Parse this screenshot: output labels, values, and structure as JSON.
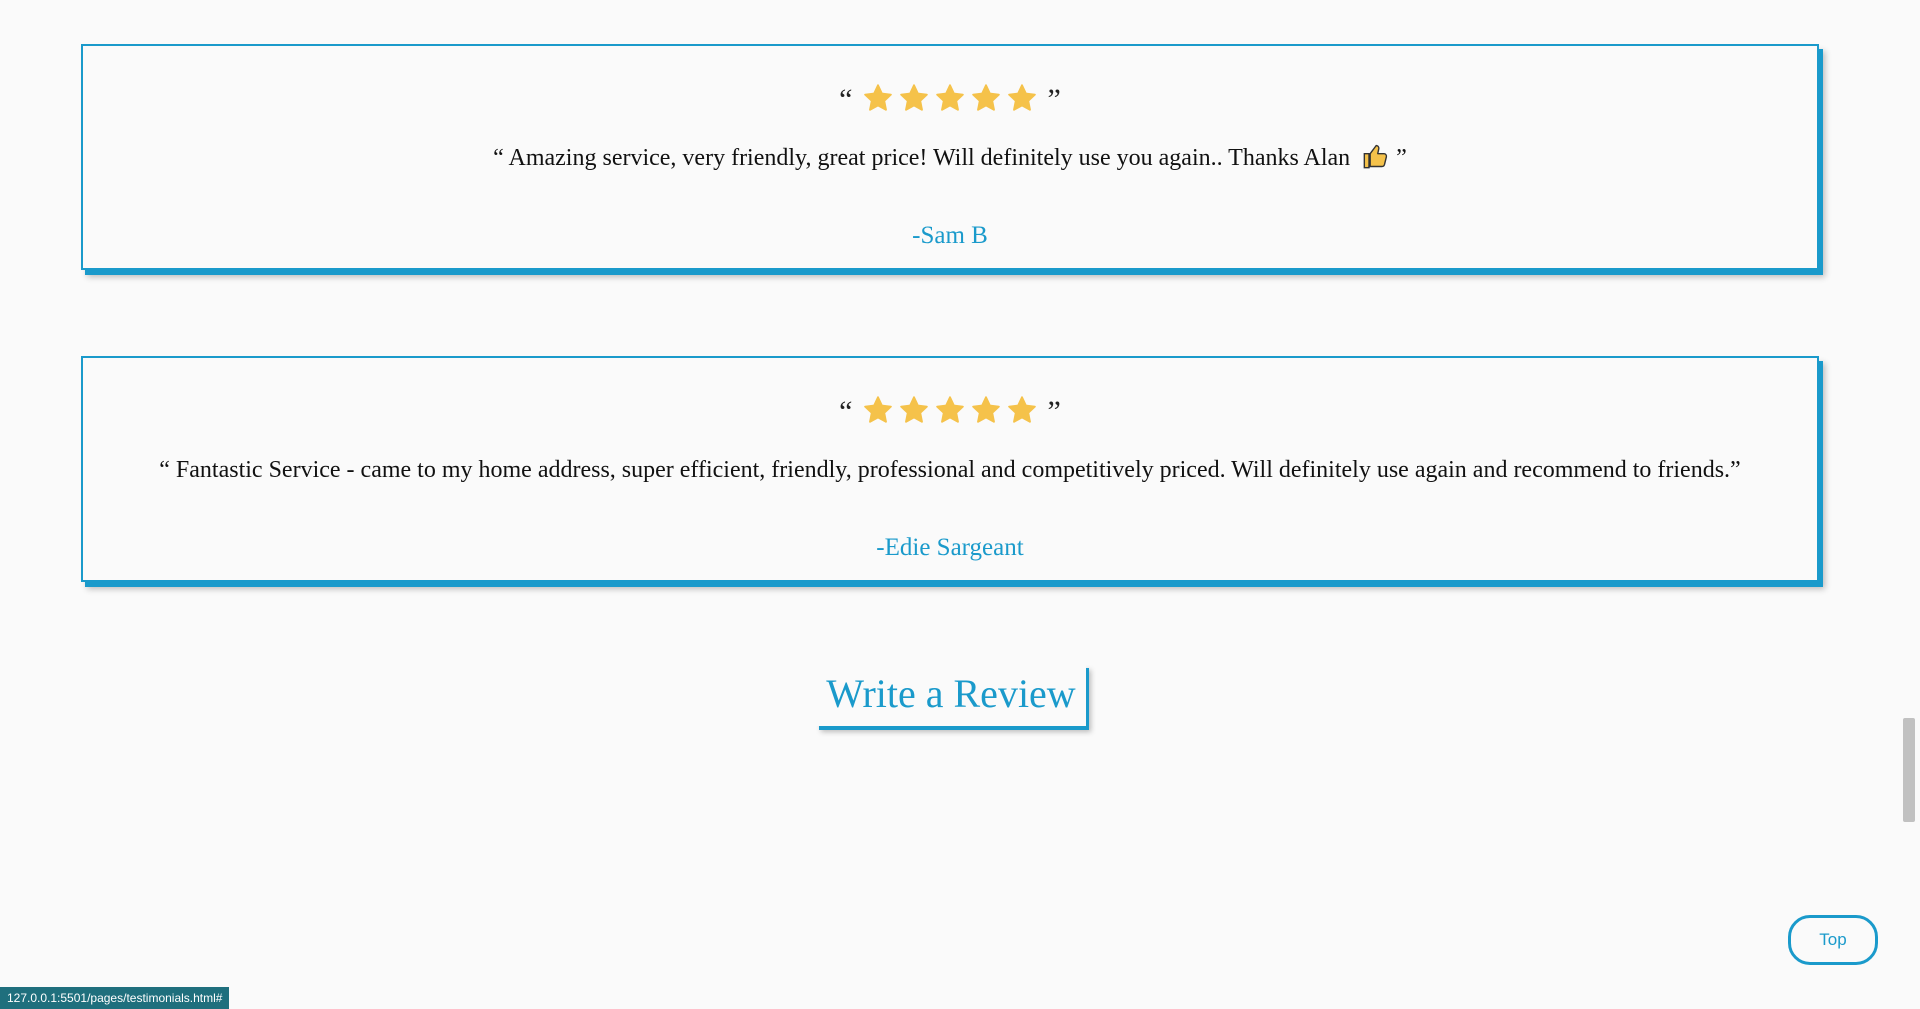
{
  "testimonials": [
    {
      "open_mark": "“",
      "close_mark": "”",
      "stars": 5,
      "quote": "“ Amazing service, very friendly, great price! Will definitely use you again.. Thanks Alan",
      "quote_end": "”",
      "author": "-Sam B"
    },
    {
      "open_mark": "“",
      "close_mark": "”",
      "stars": 5,
      "quote": "“ Fantastic Service - came to my home address, super efficient, friendly, professional and competitively priced. Will definitely use again and recommend to friends.”",
      "author": "-Edie Sargeant"
    }
  ],
  "review_button": {
    "label": "Write a Review"
  },
  "top_button": {
    "label": "Top"
  },
  "status_bar": {
    "url": "127.0.0.1:5501/pages/testimonials.html#"
  },
  "colors": {
    "accent": "#1a9acb",
    "star": "#f5c24a",
    "background": "#fafafa"
  },
  "icons": {
    "star": "star-icon",
    "thumb": "thumbs-up-icon"
  }
}
